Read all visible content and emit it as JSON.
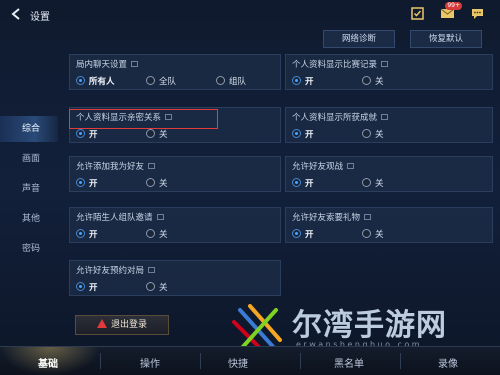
{
  "header": {
    "title": "设置",
    "mail_badge": "99+"
  },
  "actions": {
    "network_diag": "网络诊断",
    "restore_default": "恢复默认"
  },
  "sidebar": {
    "items": [
      {
        "label": "综合",
        "active": true
      },
      {
        "label": "画面",
        "active": false
      },
      {
        "label": "声音",
        "active": false
      },
      {
        "label": "其他",
        "active": false
      },
      {
        "label": "密码",
        "active": false
      }
    ]
  },
  "settings": {
    "chat": {
      "label": "局内聊天设置",
      "opt1": "所有人",
      "opt2": "全队",
      "opt3": "组队",
      "selected": "所有人"
    },
    "match_record": {
      "label": "个人资料显示比赛记录",
      "on": "开",
      "off": "关",
      "selected": "开"
    },
    "intimacy": {
      "label": "个人资料显示亲密关系",
      "on": "开",
      "off": "关",
      "selected": "开"
    },
    "achievements": {
      "label": "个人资料显示所获成就",
      "on": "开",
      "off": "关",
      "selected": "开"
    },
    "add_friend": {
      "label": "允许添加我为好友",
      "on": "开",
      "off": "关",
      "selected": "开"
    },
    "spectate": {
      "label": "允许好友观战",
      "on": "开",
      "off": "关",
      "selected": "开"
    },
    "stranger_invite": {
      "label": "允许陌生人组队邀请",
      "on": "开",
      "off": "关",
      "selected": "开"
    },
    "gift_request": {
      "label": "允许好友索要礼物",
      "on": "开",
      "off": "关",
      "selected": "开"
    },
    "reserve_match": {
      "label": "允许好友预约对局",
      "on": "开",
      "off": "关",
      "selected": "开"
    }
  },
  "logout": {
    "label": "退出登录"
  },
  "tabs": {
    "basic": "基础",
    "operation": "操作",
    "quick_msg": "快捷",
    "replay": "录像",
    "blacklist": "黑名单"
  },
  "watermark": {
    "text": "尔湾手游网",
    "url": "erwanshenghuo.com"
  },
  "colors": {
    "accent": "#4aa3ff",
    "highlight": "#e03c3c",
    "background": "#101a2c"
  }
}
